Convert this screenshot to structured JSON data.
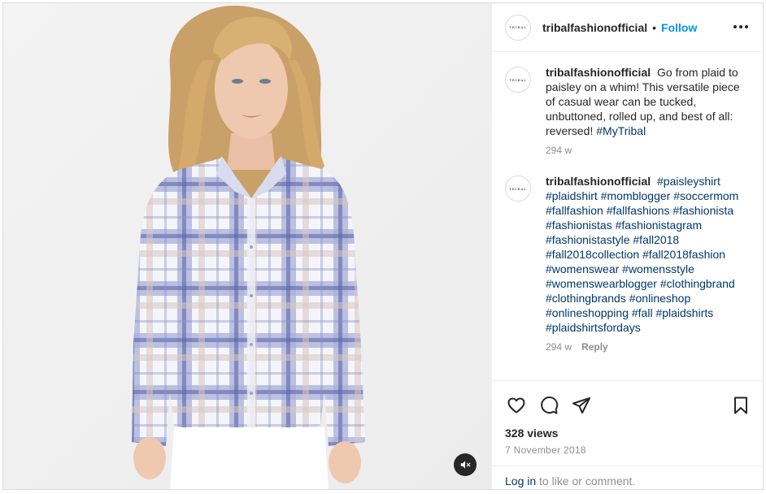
{
  "post": {
    "media": {
      "image_alt": "Model wearing blue and white plaid button-up shirt",
      "mute_icon": "speaker-muted-icon"
    },
    "header": {
      "avatar_text": "TRIBAL",
      "username": "tribalfashionofficial",
      "separator": "•",
      "follow_label": "Follow",
      "more_icon": "more-options-icon"
    },
    "comments": [
      {
        "avatar_text": "TRIBAL",
        "username": "tribalfashionofficial",
        "text": "Go from plaid to paisley on a whim! This versatile piece of casual wear can be tucked, unbuttoned, rolled up, and best of all: reversed!",
        "hashtags": "#MyTribal",
        "time": "294 w",
        "reply": ""
      },
      {
        "avatar_text": "TRIBAL",
        "username": "tribalfashionofficial",
        "text": "",
        "hashtags": "#paisleyshirt #plaidshirt #momblogger #soccermom #fallfashion #fallfashions #fashionista #fashionistas #fashionistagram #fashionistastyle #fall2018 #fall2018collection #fall2018fashion #womenswear #womensstyle #womenswearblogger #clothingbrand #clothingbrands #onlineshop #onlineshopping #fall #plaidshirts #plaidshirtsfordays",
        "time": "294 w",
        "reply": "Reply"
      }
    ],
    "actions": {
      "like_icon": "heart-icon",
      "comment_icon": "comment-icon",
      "share_icon": "share-icon",
      "save_icon": "bookmark-icon",
      "views": "328 views",
      "date": "7 November 2018",
      "login_link": "Log in",
      "login_suffix": " to like or comment."
    },
    "colors": {
      "follow_blue": "#0095f6",
      "hashtag_blue": "#00376b",
      "muted_gray": "#8e8e8e",
      "border": "#dbdbdb"
    }
  }
}
